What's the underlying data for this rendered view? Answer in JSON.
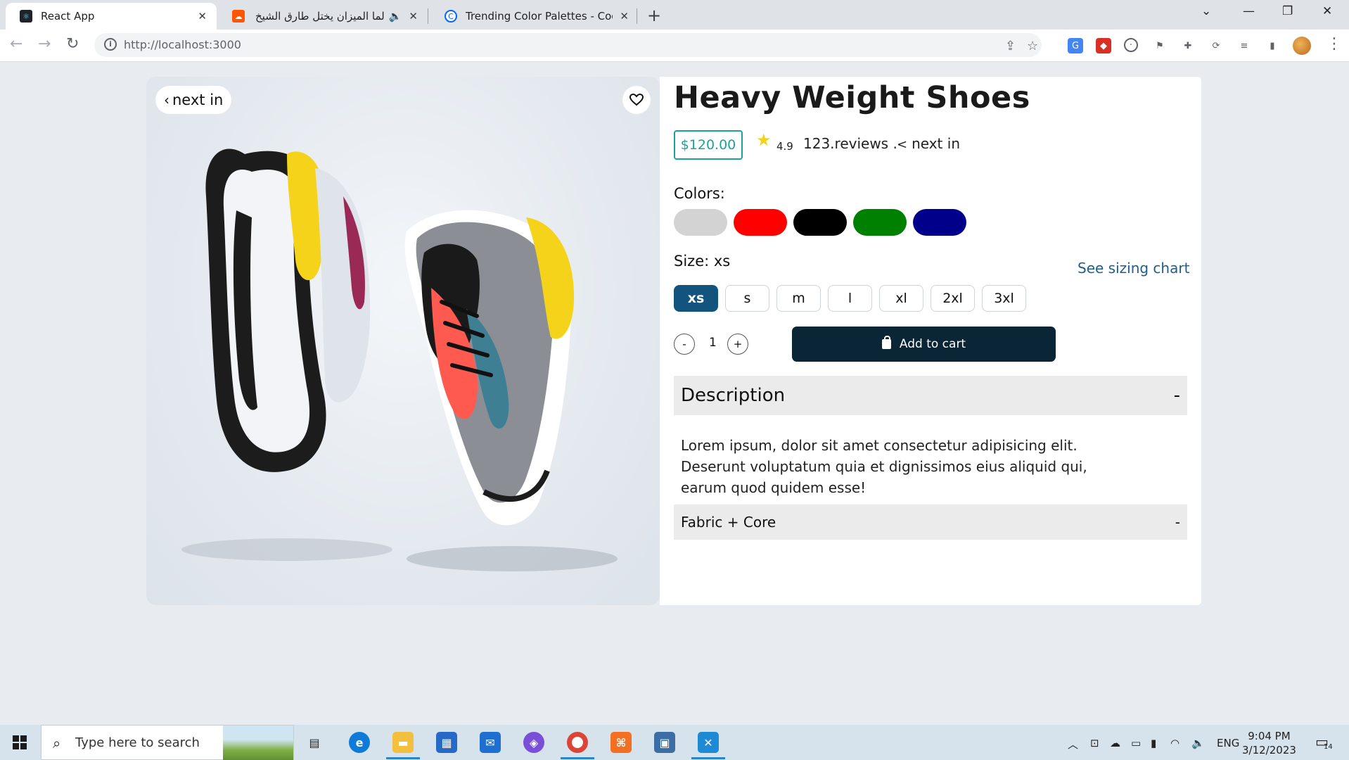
{
  "browser": {
    "tabs": [
      {
        "title": "React App",
        "favicon": "react-icon",
        "active": true
      },
      {
        "title": "لما الميزان يختل طارق الشيخ .en",
        "favicon": "soundcloud-icon",
        "active": false
      },
      {
        "title": "Trending Color Palettes - Coolors",
        "favicon": "coolors-icon",
        "active": false
      }
    ],
    "url": "http://localhost:3000"
  },
  "product": {
    "title": "Heavy Weight Shoes",
    "price": "$120.00",
    "rating": "4.9",
    "reviews": "123.reviews .",
    "next_label": "next in",
    "back_label": "next in",
    "colors_label": "Colors:",
    "colors": [
      "#d3d3d3",
      "#ff0000",
      "#000000",
      "#008000",
      "#00008b"
    ],
    "size_label": "Size: xs",
    "sizing_chart_label": "See sizing chart",
    "sizes": [
      "xs",
      "s",
      "m",
      "l",
      "xl",
      "2xl",
      "3xl"
    ],
    "selected_size": "xs",
    "quantity": "1",
    "qty_minus": "-",
    "qty_plus": "+",
    "add_to_cart": "Add to cart",
    "description_title": "Description",
    "description_toggle": "-",
    "description_text": "Lorem ipsum, dolor sit amet consectetur adipisicing elit. Deserunt voluptatum quia et dignissimos eius aliquid qui, earum quod quidem esse!",
    "fabric_title": "Fabric + Core",
    "fabric_toggle": "-"
  },
  "taskbar": {
    "search_placeholder": "Type here to search",
    "language": "ENG",
    "time": "9:04 PM",
    "date": "3/12/2023",
    "notifications": "14"
  },
  "colors": {
    "accent_teal": "#1aa39a",
    "size_selected": "#12547d",
    "cart_button": "#0a2536",
    "sizing_link": "#1d5f8c"
  }
}
